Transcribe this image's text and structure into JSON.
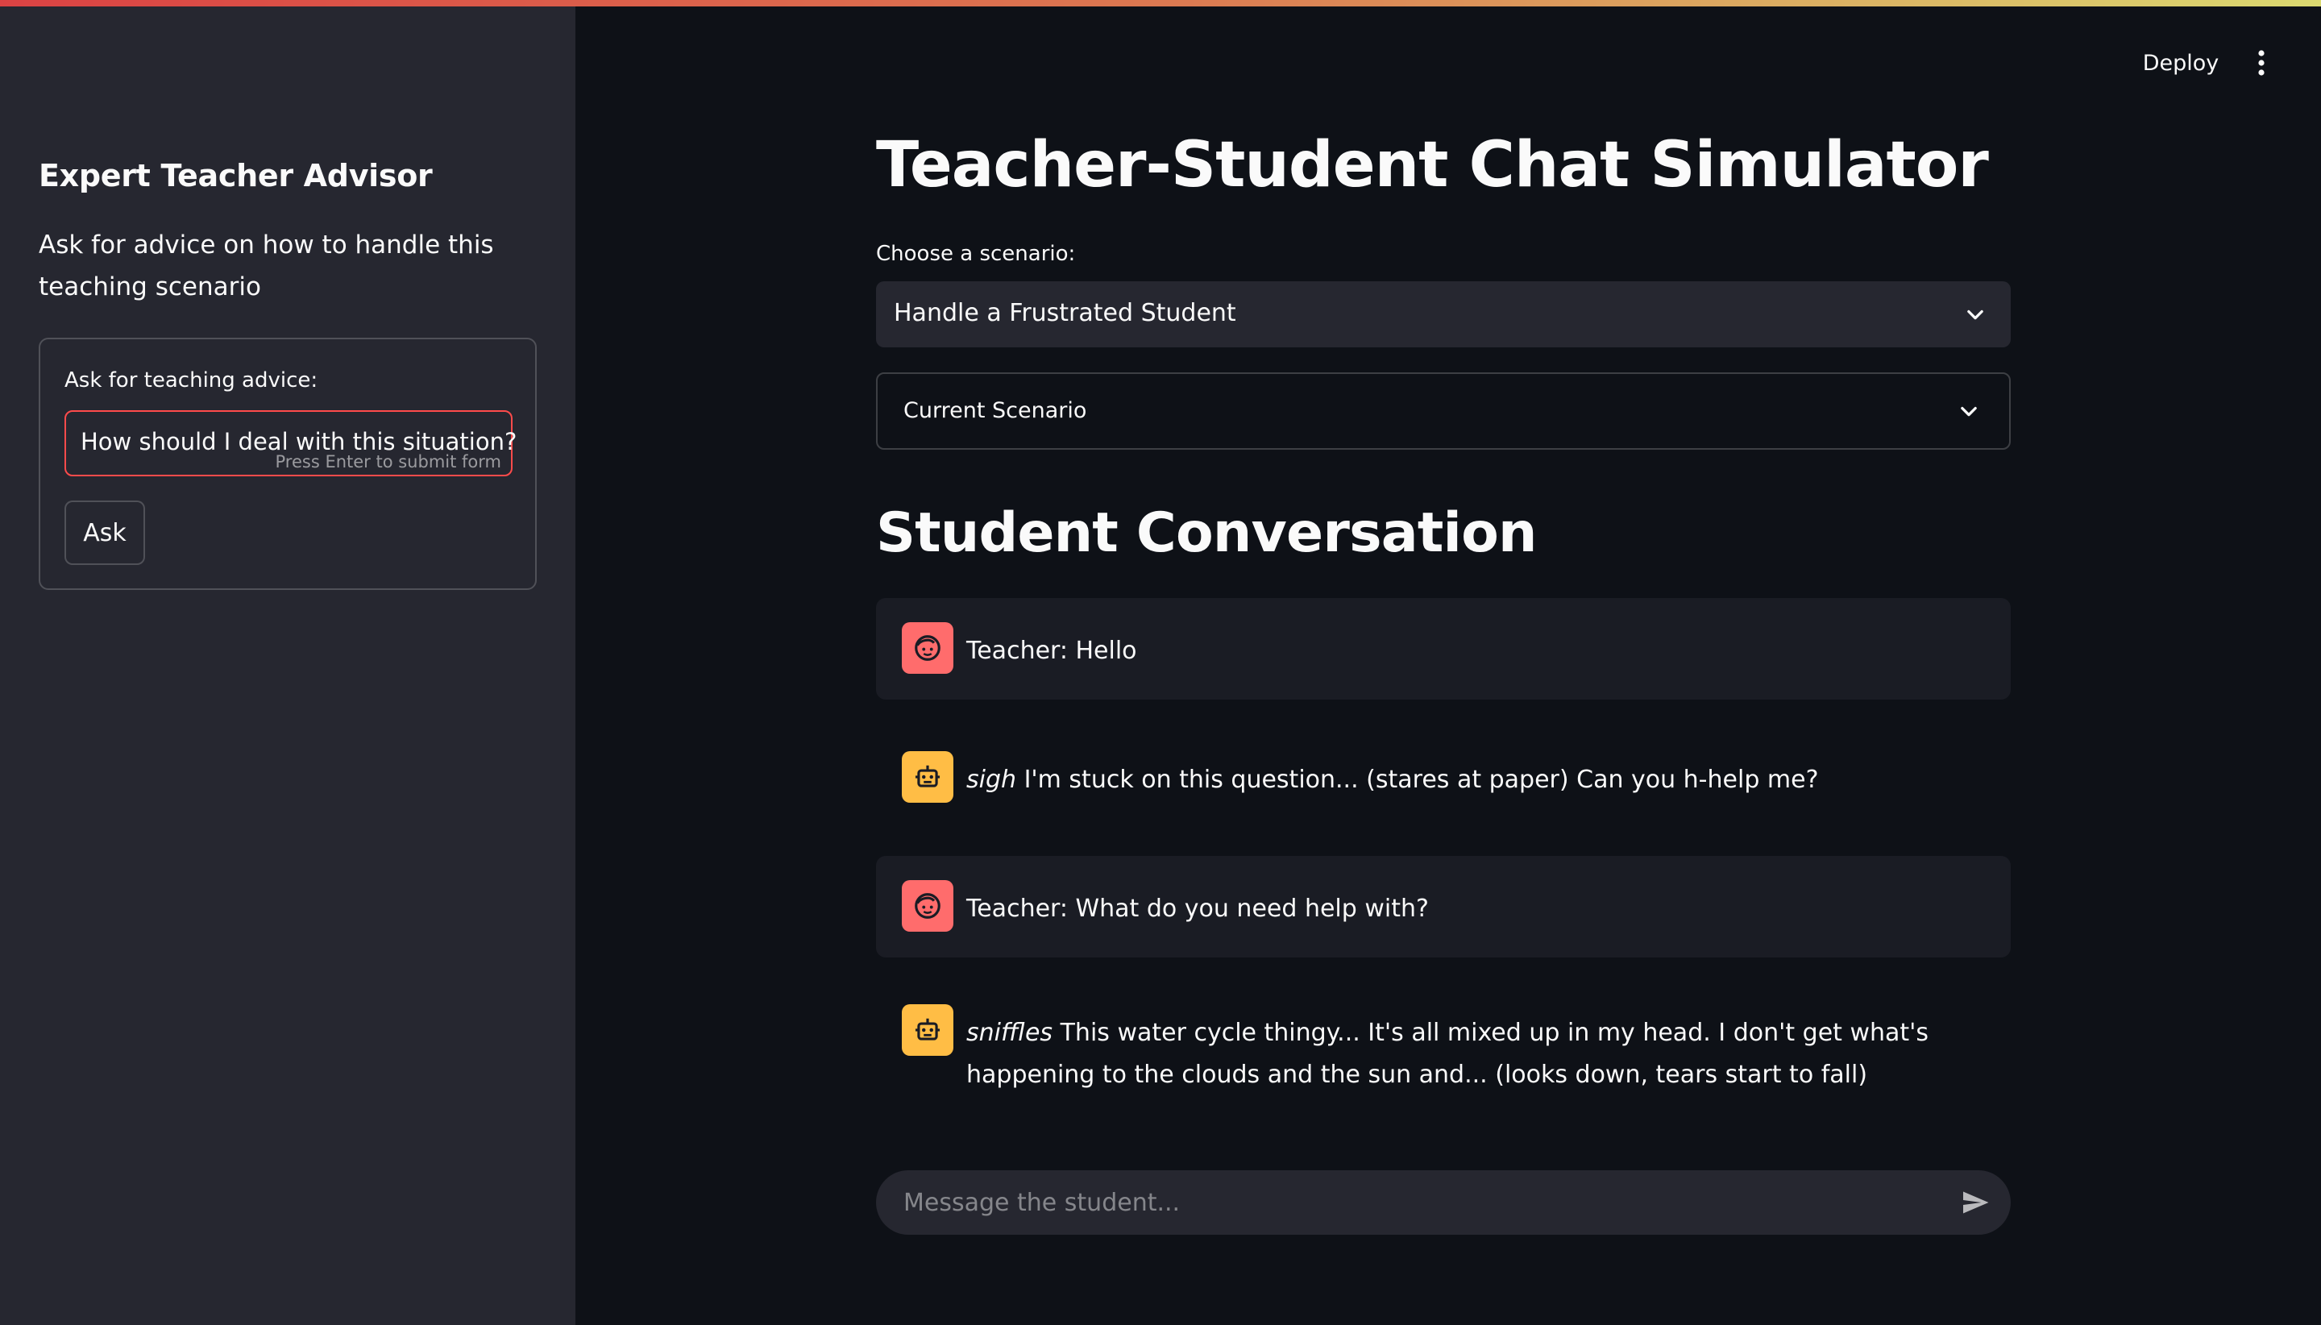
{
  "header": {
    "deploy_label": "Deploy"
  },
  "sidebar": {
    "title": "Expert Teacher Advisor",
    "description": "Ask for advice on how to handle this teaching scenario",
    "form": {
      "label": "Ask for teaching advice:",
      "input_value": "How should I deal with this situation?",
      "input_hint": "Press Enter to submit form",
      "ask_label": "Ask"
    }
  },
  "main": {
    "title": "Teacher-Student Chat Simulator",
    "scenario_label": "Choose a scenario:",
    "scenario_selected": "Handle a Frustrated Student",
    "expander_label": "Current Scenario",
    "conversation_title": "Student Conversation",
    "messages": [
      {
        "role": "teacher",
        "avatar_icon": "user-face-icon",
        "text": "Teacher: Hello"
      },
      {
        "role": "student",
        "avatar_icon": "robot-icon",
        "emphasis": "sigh",
        "text": " I'm stuck on this question... (stares at paper) Can you h-help me?"
      },
      {
        "role": "teacher",
        "avatar_icon": "user-face-icon",
        "text": "Teacher: What do you need help with?"
      },
      {
        "role": "student",
        "avatar_icon": "robot-icon",
        "emphasis": "sniffles",
        "text": " This water cycle thingy... It's all mixed up in my head. I don't get what's happening to the clouds and the sun and... (looks down, tears start to fall)"
      }
    ],
    "chat_input_placeholder": "Message the student..."
  },
  "colors": {
    "background": "#0e1117",
    "sidebar": "#262730",
    "accent": "#ff4b4b",
    "teacher_avatar": "#ff6c6c",
    "student_avatar": "#ffbd45"
  }
}
